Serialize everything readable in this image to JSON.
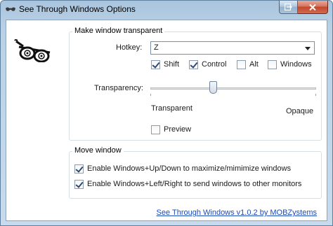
{
  "window": {
    "title": "See Through Windows Options"
  },
  "icons": {
    "app": "glasses-app-icon",
    "glasses": "sunglasses-icon",
    "restore": "restore-window-icon",
    "close": "close-icon"
  },
  "transparent_group": {
    "title": "Make window transparent",
    "hotkey_label": "Hotkey:",
    "hotkey_value": "Z",
    "modifiers": [
      {
        "label": "Shift",
        "checked": true
      },
      {
        "label": "Control",
        "checked": true
      },
      {
        "label": "Alt",
        "checked": false
      },
      {
        "label": "Windows",
        "checked": false
      }
    ],
    "transparency_label": "Transparency:",
    "transparency_level": 0.38,
    "slider_min_label": "Transparent",
    "slider_max_label": "Opaque",
    "preview_label": "Preview",
    "preview_checked": false
  },
  "move_group": {
    "title": "Move window",
    "options": [
      {
        "label": "Enable Windows+Up/Down to maximize/mimimize windows",
        "checked": true
      },
      {
        "label": "Enable Windows+Left/Right to send windows to other monitors",
        "checked": true
      }
    ]
  },
  "footer": {
    "link_text": "See Through Windows v1.0.2 by MOBZystems"
  },
  "colors": {
    "link": "#1a4bb8",
    "close_button": "#c2472c",
    "title_bar": "#b9d1e6"
  }
}
